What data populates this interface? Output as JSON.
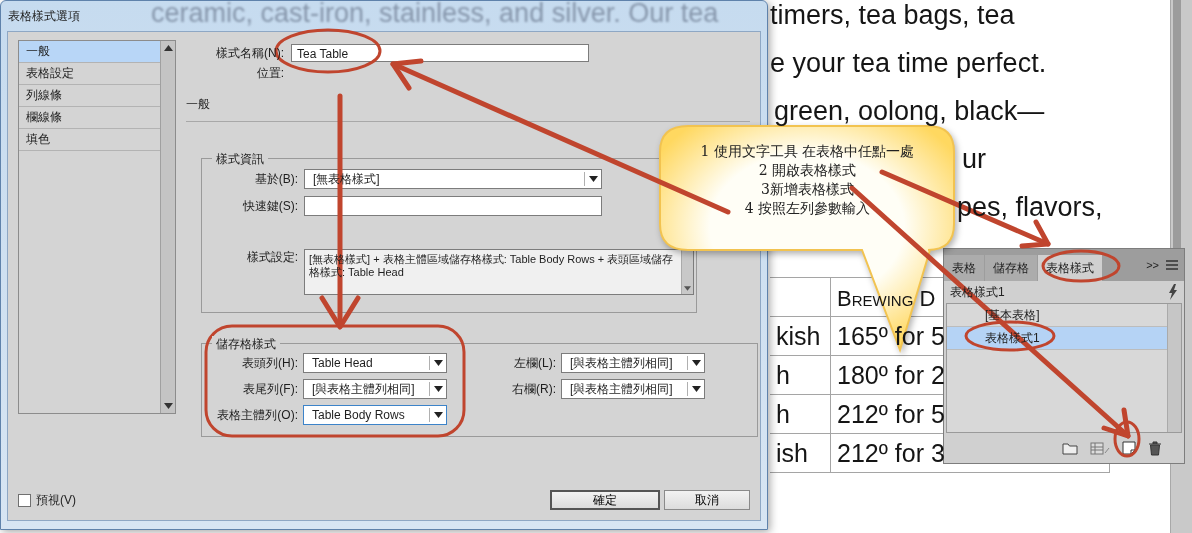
{
  "document": {
    "behind_glass": "ceramic, cast-iron, stainless, and silver. Our tea",
    "lines": [
      "timers, tea bags, tea",
      "e your tea time perfect.",
      "green, oolong, black—",
      "ur",
      "pes, flavors,"
    ],
    "table": {
      "heading": "Brewing D",
      "rows": [
        {
          "col_1": "kish",
          "col_2": "165º for 5"
        },
        {
          "col_1": "h",
          "col_2": "180º for 2"
        },
        {
          "col_1": "h",
          "col_2": "212º for 5"
        },
        {
          "col_1": "ish",
          "col_2": "212º for 3"
        }
      ]
    }
  },
  "panel": {
    "tabs": [
      {
        "label": "表格",
        "selected": false
      },
      {
        "label": "儲存格",
        "selected": false
      },
      {
        "label": "表格樣式",
        "selected": true
      }
    ],
    "overflow": ">>",
    "current_style": "表格樣式1",
    "styles": [
      {
        "label": "[基本表格]",
        "selected": false
      },
      {
        "label": "表格樣式1",
        "selected": true
      }
    ]
  },
  "dialog": {
    "title": "表格樣式選項",
    "sidebar": [
      {
        "label": "一般",
        "selected": true
      },
      {
        "label": "表格設定",
        "selected": false
      },
      {
        "label": "列線條",
        "selected": false
      },
      {
        "label": "欄線條",
        "selected": false
      },
      {
        "label": "填色",
        "selected": false
      }
    ],
    "style_name": {
      "label": "樣式名稱(N):",
      "value": "Tea Table"
    },
    "location": {
      "label": "位置:"
    },
    "section_title": "一般",
    "style_info": {
      "title": "樣式資訊",
      "based_on": {
        "label": "基於(B):",
        "value": "[無表格樣式]"
      },
      "shortcut": {
        "label": "快速鍵(S):"
      },
      "settings": {
        "label": "樣式設定:",
        "value": "[無表格樣式]  + 表格主體區域儲存格樣式: Table Body Rows + 表頭區域儲存格樣式: Table Head"
      }
    },
    "cell_styles": {
      "title": "儲存格樣式",
      "fields": [
        {
          "label": "表頭列(H):",
          "value": "Table Head",
          "focused": false
        },
        {
          "label": "左欄(L):",
          "value": "[與表格主體列相同]",
          "focused": false
        },
        {
          "label": "表尾列(F):",
          "value": "[與表格主體列相同]",
          "focused": false
        },
        {
          "label": "右欄(R):",
          "value": "[與表格主體列相同]",
          "focused": false
        },
        {
          "label": "表格主體列(O):",
          "value": "Table Body Rows",
          "focused": true
        }
      ]
    },
    "preview": {
      "label": "預視(V)",
      "checked": false
    },
    "buttons": [
      {
        "label": "確定",
        "default": true
      },
      {
        "label": "取消",
        "default": false
      }
    ]
  },
  "callout": {
    "steps": [
      "1 使用文字工具 在表格中任點一處",
      "2 開啟表格樣式",
      "3新增表格樣式",
      "4 按照左列參數輸入"
    ]
  }
}
